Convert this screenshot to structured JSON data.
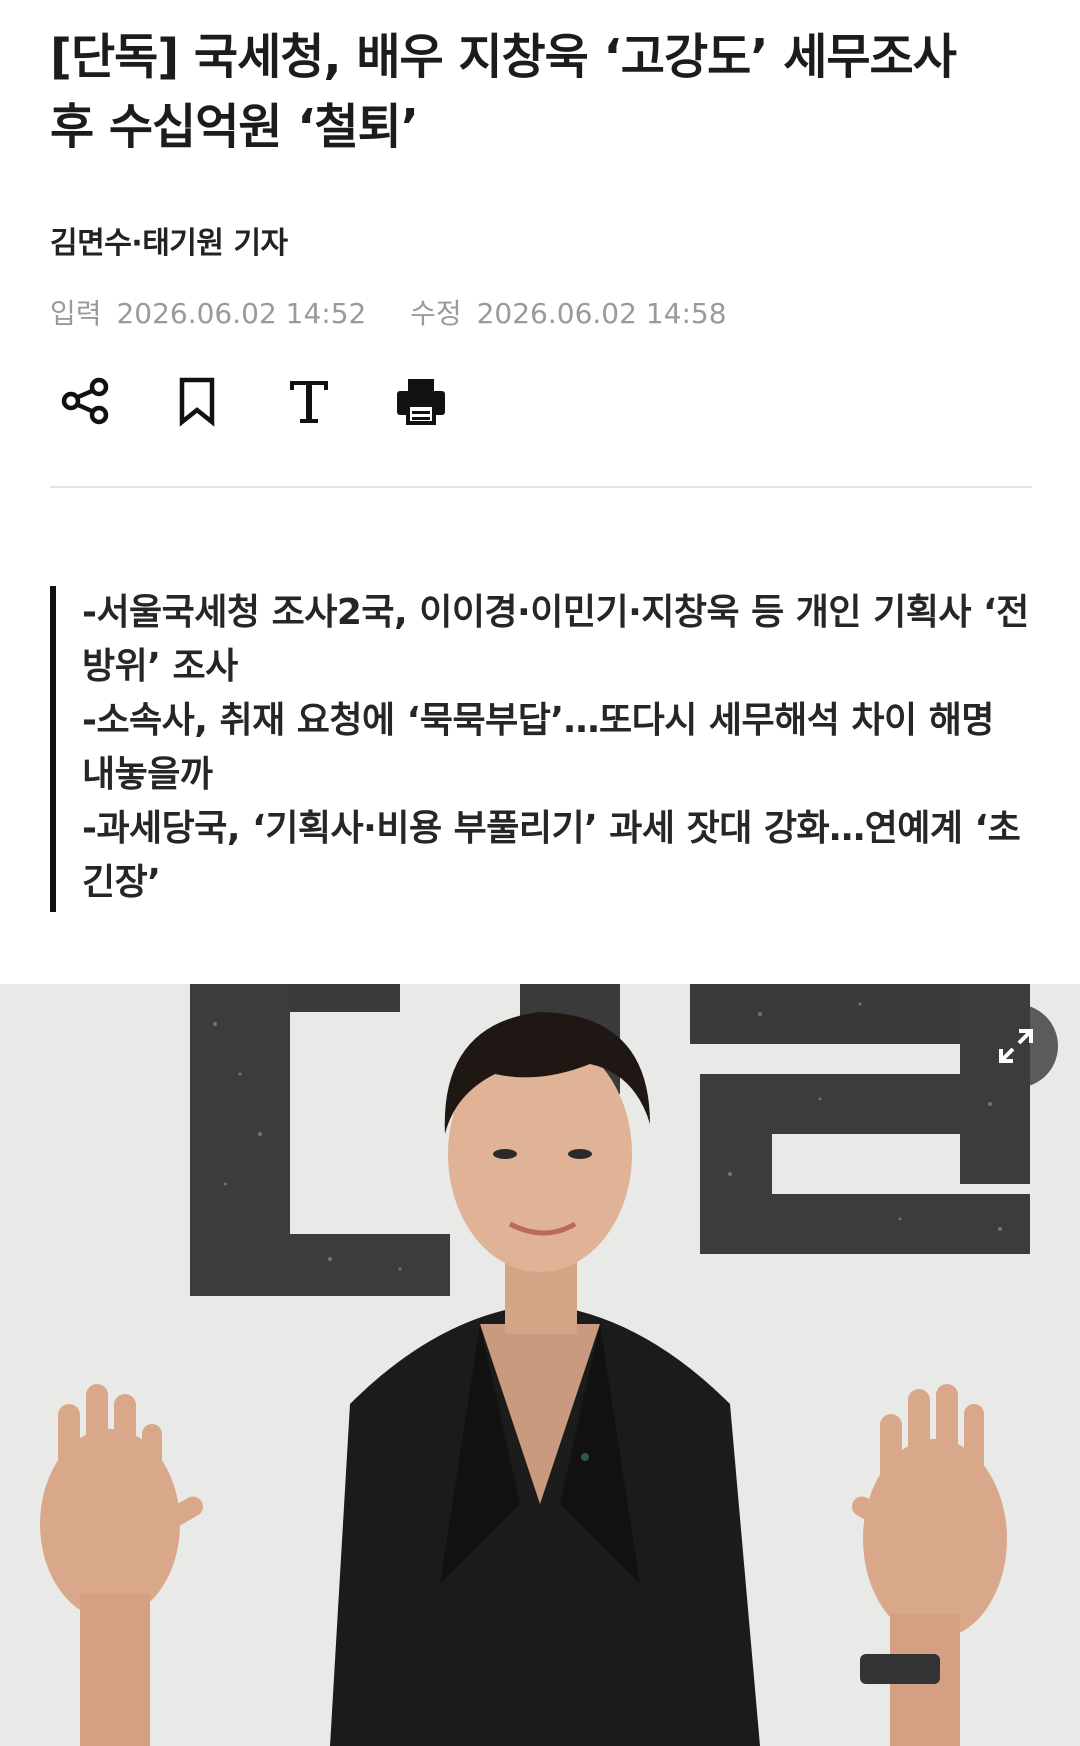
{
  "article": {
    "headline": "[단독] 국세청, 배우 지창욱 ‘고강도’ 세무조사 후 수십억원 ‘철퇴’",
    "byline": "김면수·태기원 기자",
    "dates": {
      "input_label": "입력",
      "input_value": "2026.06.02 14:52",
      "modified_label": "수정",
      "modified_value": "2026.06.02 14:58"
    },
    "toolbar": {
      "share_icon": "share-icon",
      "bookmark_icon": "bookmark-icon",
      "font_size_icon": "font-size-icon",
      "print_icon": "print-icon"
    },
    "summary": [
      "-서울국세청 조사2국, 이이경·이민기·지창욱 등 개인 기획사 ‘전방위’ 조사",
      "-소속사, 취재 요청에 ‘묵묵부답’…또다시 세무해석 차이 해명 내놓을까",
      "-과세당국, ‘기획사·비용 부풀리기’ 과세 잣대 강화…연예계 ‘초긴장’"
    ],
    "photo": {
      "expand_icon": "expand-icon"
    }
  },
  "colors": {
    "text": "#1c1c1c",
    "meta": "#9a9a9a",
    "divider": "#e4e4e4",
    "summary_bar": "#111111"
  }
}
